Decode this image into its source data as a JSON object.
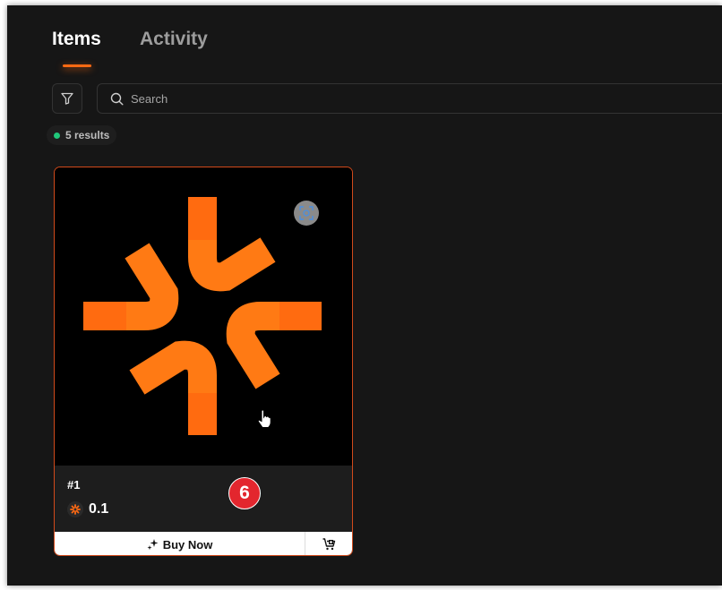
{
  "tabs": [
    {
      "label": "Items",
      "active": true
    },
    {
      "label": "Activity",
      "active": false
    }
  ],
  "search": {
    "placeholder": "Search",
    "value": ""
  },
  "results": {
    "label": "5 results"
  },
  "card": {
    "token_id": "#1",
    "price": "0.1",
    "buy_label": "Buy Now"
  },
  "annotation": {
    "step": "6"
  },
  "icons": {
    "filter": "filter-icon",
    "search": "search-icon",
    "scan": "scan-icon",
    "coin": "coin-icon",
    "sparkle": "sparkle-icon",
    "cart": "add-to-cart-icon",
    "cursor": "hand-cursor-icon"
  },
  "colors": {
    "accent": "#ff6a13",
    "status_dot": "#20c77a",
    "badge": "#e3262e",
    "background": "#161616"
  }
}
